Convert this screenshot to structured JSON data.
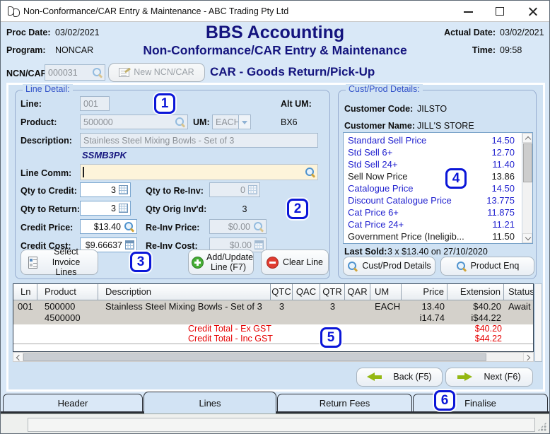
{
  "window": {
    "title": "Non-Conformance/CAR Entry & Maintenance - ABC Trading Pty Ltd"
  },
  "header": {
    "proc_date_label": "Proc Date:",
    "proc_date": "03/02/2021",
    "program_label": "Program:",
    "program": "NONCAR",
    "app_title": "BBS Accounting",
    "screen_title": "Non-Conformance/CAR Entry & Maintenance",
    "actual_date_label": "Actual Date:",
    "actual_date": "03/02/2021",
    "time_label": "Time:",
    "time": "09:58",
    "ncn_label": "NCN/CAR:",
    "ncn_value": "000031",
    "new_ncn_button": "New NCN/CAR",
    "mode_title": "CAR - Goods Return/Pick-Up"
  },
  "line_detail": {
    "legend": "Line Detail:",
    "line_label": "Line:",
    "line_value": "001",
    "alt_um_label": "Alt UM:",
    "alt_um_value": "BX6",
    "product_label": "Product:",
    "product_value": "500000",
    "um_label": "UM:",
    "um_value": "EACH",
    "description_label": "Description:",
    "description_value": "Stainless Steel Mixing Bowls - Set of 3",
    "product_code": "SSMB3PK",
    "line_comm_label": "Line Comm:",
    "line_comm_value": "",
    "qty_to_credit_label": "Qty to Credit:",
    "qty_to_credit": "3",
    "qty_to_reinv_label": "Qty to Re-Inv:",
    "qty_to_reinv": "0",
    "qty_to_return_label": "Qty to Return:",
    "qty_to_return": "3",
    "qty_orig_label": "Qty Orig Inv'd:",
    "qty_orig": "3",
    "credit_price_label": "Credit Price:",
    "credit_price": "$13.40",
    "reinv_price_label": "Re-Inv Price:",
    "reinv_price": "$0.00",
    "credit_cost_label": "Credit Cost:",
    "credit_cost": "$9.66637",
    "reinv_cost_label": "Re-Inv Cost:",
    "reinv_cost": "$0.00",
    "select_invoice_button": "Select Invoice Lines",
    "add_update_button": "Add/Update Line (F7)",
    "clear_line_button": "Clear Line"
  },
  "cust_prod": {
    "legend": "Cust/Prod Details:",
    "customer_code_label": "Customer Code:",
    "customer_code": "JILSTO",
    "customer_name_label": "Customer Name:",
    "customer_name": "JILL'S STORE",
    "price_list": [
      {
        "label": "Standard Sell Price",
        "value": "14.50",
        "highlight": true
      },
      {
        "label": "Std Sell 6+",
        "value": "12.70",
        "highlight": true
      },
      {
        "label": "Std Sell 24+",
        "value": "11.40",
        "highlight": true
      },
      {
        "label": "Sell Now Price",
        "value": "13.86",
        "highlight": false
      },
      {
        "label": "Catalogue Price",
        "value": "14.50",
        "highlight": true
      },
      {
        "label": "Discount Catalogue Price",
        "value": "13.775",
        "highlight": true
      },
      {
        "label": "Cat Price 6+",
        "value": "11.875",
        "highlight": true
      },
      {
        "label": "Cat Price 24+",
        "value": "11.21",
        "highlight": true
      },
      {
        "label": "Government Price (Ineligib...",
        "value": "11.50",
        "highlight": false
      }
    ],
    "last_sold_label": "Last Sold:",
    "last_sold": "3 x $13.40 on 27/10/2020",
    "cust_prod_button": "Cust/Prod Details",
    "product_enq_button": "Product Enq"
  },
  "lines_table": {
    "columns": [
      "Ln",
      "Product",
      "Description",
      "QTC",
      "QAC",
      "QTR",
      "QAR",
      "UM",
      "Price",
      "Extension",
      "Status"
    ],
    "row": {
      "ln": "001",
      "product": "500000",
      "product2": "4500000",
      "description": "Stainless Steel Mixing Bowls - Set of 3",
      "qtc": "3",
      "qac": "",
      "qtr": "3",
      "qar": "",
      "um": "EACH",
      "price": "13.40",
      "price2": "i14.74",
      "extension": "$40.20",
      "extension2": "i$44.22",
      "status": "Await"
    },
    "totals": [
      {
        "label": "Credit Total - Ex GST",
        "value": "$40.20"
      },
      {
        "label": "Credit Total - Inc GST",
        "value": "$44.22"
      }
    ]
  },
  "footer": {
    "back_button": "Back (F5)",
    "next_button": "Next (F6)",
    "tabs": [
      {
        "label": "Header",
        "active": false
      },
      {
        "label": "Lines",
        "active": true
      },
      {
        "label": "Return Fees",
        "active": false
      },
      {
        "label": "Finalise",
        "active": false
      }
    ]
  },
  "annotations": {
    "a1": "1",
    "a2": "2",
    "a3": "3",
    "a4": "4",
    "a5": "5",
    "a6": "6"
  },
  "colors": {
    "accent_navy": "#14147e",
    "annotation_blue": "#0b16d8",
    "link_blue": "#2121cf",
    "total_red": "#e60000"
  }
}
